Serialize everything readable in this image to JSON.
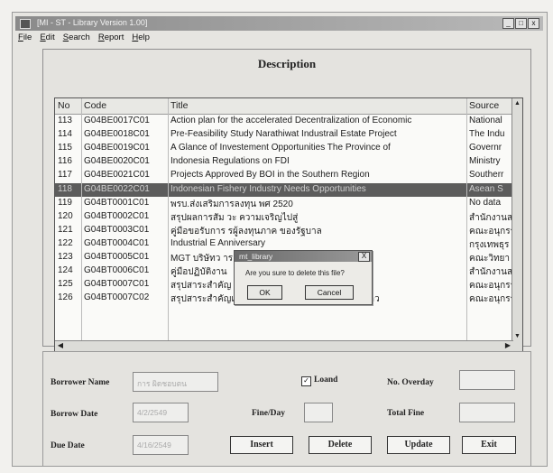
{
  "window": {
    "title": "[MI - ST - Library Version 1.00]",
    "buttons": [
      "_",
      "□",
      "x"
    ]
  },
  "menu": [
    "File",
    "Edit",
    "Search",
    "Report",
    "Help"
  ],
  "panel": {
    "title": "Description"
  },
  "table": {
    "columns": [
      "No",
      "Code",
      "Title",
      "Source"
    ],
    "rows": [
      {
        "no": "113",
        "code": "G04BE0017C01",
        "title": "Action plan for the accelerated Decentralization of Economic",
        "source": "National"
      },
      {
        "no": "114",
        "code": "G04BE0018C01",
        "title": "Pre-Feasibility Study Narathiwat Industrail Estate Project",
        "source": "The Indu"
      },
      {
        "no": "115",
        "code": "G04BE0019C01",
        "title": "A Glance of Investement Opportunities The Province of",
        "source": "Governr"
      },
      {
        "no": "116",
        "code": "G04BE0020C01",
        "title": "Indonesia Regulations on FDI",
        "source": "Ministry"
      },
      {
        "no": "117",
        "code": "G04BE0021C01",
        "title": "Projects Approved By BOI in the Southern Region",
        "source": "Southerr"
      },
      {
        "no": "118",
        "code": "G04BE0022C01",
        "title": "Indonesian Fishery Industry Needs Opportunities",
        "source": "Asean S"
      },
      {
        "no": "119",
        "code": "G04BT0001C01",
        "title": "พรบ.ส่งเสริมการลงทุน พศ 2520",
        "source": "No data"
      },
      {
        "no": "120",
        "code": "G04BT0002C01",
        "title": "สรุปผลการสัม                               วะ ความเจริญไปสู่",
        "source": "สำนักงานส"
      },
      {
        "no": "121",
        "code": "G04BT0003C01",
        "title": "คู่มือขอรับการ                               รผู้ลงทุนภาค ของรัฐบาล",
        "source": "คณะอนุกรร"
      },
      {
        "no": "122",
        "code": "G04BT0004C01",
        "title": "Industrial E                                    Anniversary",
        "source": "กรุงเทพธุร"
      },
      {
        "no": "123",
        "code": "G04BT0005C01",
        "title": "MGT บริษัทว                                   าร สถาบันระดับรัฐ",
        "source": "คณะวิทยา"
      },
      {
        "no": "124",
        "code": "G04BT0006C01",
        "title": "คู่มือปฏิบัติงาน",
        "source": "สำนักงานส"
      },
      {
        "no": "125",
        "code": "G04BT0007C01",
        "title": "สรุปสาระสำคัญ",
        "source": "คณะอนุกรร"
      },
      {
        "no": "126",
        "code": "G04BT0007C02",
        "title": "สรุปสาระสำคัญแผนลงทุนจังหวัดจำนงสมเป็นระยะยาว",
        "source": "คณะอนุกรร"
      }
    ],
    "selected_row": "118"
  },
  "dialog": {
    "title": "mt_library",
    "close": "X",
    "message": "Are you sure to delete this file?",
    "ok_label": "OK",
    "cancel_label": "Cancel"
  },
  "form": {
    "borrower_name_label": "Borrower Name",
    "borrower_name_value": "การ ผิดชอบตน",
    "loand_label": "Loand",
    "loand_checked": true,
    "overdue_label": "No. Overday",
    "overdue_value": "",
    "borrow_date_label": "Borrow Date",
    "borrow_date_value": "4/2/2549",
    "fine_day_label": "Fine/Day",
    "fine_day_value": "",
    "total_fine_label": "Total Fine",
    "total_fine_value": "",
    "due_date_label": "Due Date",
    "due_date_value": "4/16/2549",
    "insert_label": "Insert",
    "delete_label": "Delete",
    "update_label": "Update",
    "exit_label": "Exit"
  }
}
